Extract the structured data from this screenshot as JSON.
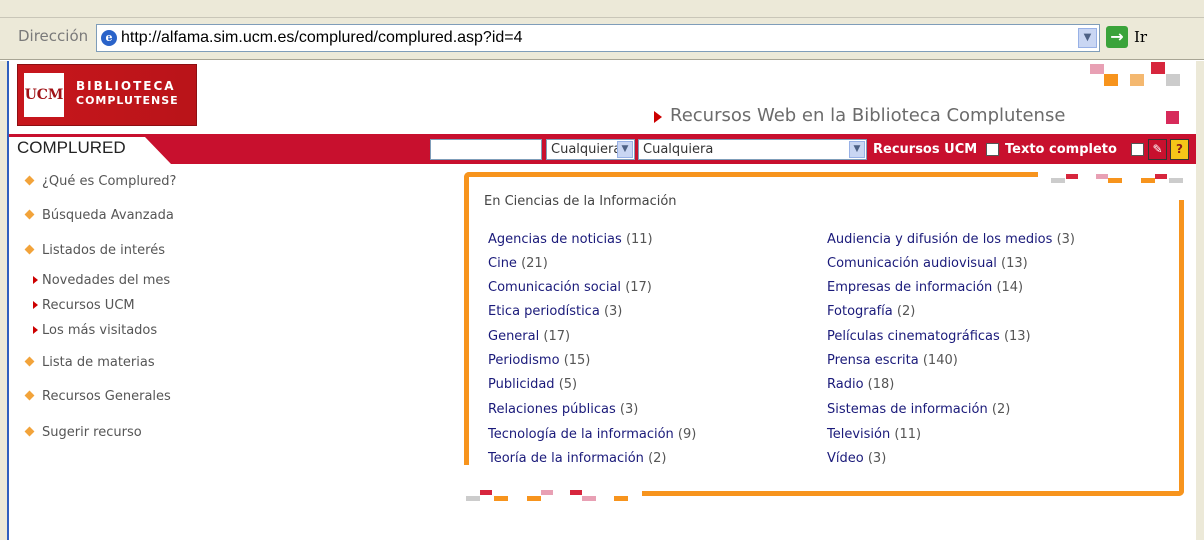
{
  "browser": {
    "address_label": "Dirección",
    "url": "http://alfama.sim.ucm.es/complured/complured.asp?id=4",
    "go_label": "Ir"
  },
  "header": {
    "logo_seal": "UCM",
    "logo_line1": "BIBLIOTECA",
    "logo_line2": "COMPLUTENSE",
    "title": "Recursos Web en la Biblioteca Complutense"
  },
  "searchbar": {
    "tab_label": "COMPLURED",
    "search_value": "",
    "select1_value": "Cualquiera",
    "select2_value": "Cualquiera",
    "check1_label": "Recursos UCM",
    "check2_label": "Texto completo",
    "accent_color": "#c8102e"
  },
  "sidebar": {
    "items": [
      {
        "label": "¿Qué es Complured?"
      },
      {
        "label": "Búsqueda Avanzada"
      },
      {
        "label": "Listados de interés"
      },
      {
        "label": "Lista de materias"
      },
      {
        "label": "Recursos Generales"
      },
      {
        "label": "Sugerir recurso"
      }
    ],
    "subitems": [
      {
        "label": "Novedades del mes"
      },
      {
        "label": "Recursos UCM"
      },
      {
        "label": "Los más visitados"
      }
    ]
  },
  "content": {
    "heading": "En Ciencias de la Información",
    "left_column": [
      {
        "name": "Agencias de noticias",
        "count": "(11)"
      },
      {
        "name": "Cine",
        "count": "(21)"
      },
      {
        "name": "Comunicación social",
        "count": "(17)"
      },
      {
        "name": "Etica periodística",
        "count": "(3)"
      },
      {
        "name": "General",
        "count": "(17)"
      },
      {
        "name": "Periodismo",
        "count": "(15)"
      },
      {
        "name": "Publicidad",
        "count": "(5)"
      },
      {
        "name": "Relaciones públicas",
        "count": "(3)"
      },
      {
        "name": "Tecnología de la información",
        "count": "(9)"
      },
      {
        "name": "Teoría de la información",
        "count": "(2)"
      }
    ],
    "right_column": [
      {
        "name": "Audiencia y difusión de los medios",
        "count": "(3)"
      },
      {
        "name": "Comunicación audiovisual",
        "count": "(13)"
      },
      {
        "name": "Empresas de información",
        "count": "(14)"
      },
      {
        "name": "Fotografía",
        "count": "(2)"
      },
      {
        "name": "Películas cinematográficas",
        "count": "(13)"
      },
      {
        "name": "Prensa escrita",
        "count": "(140)"
      },
      {
        "name": "Radio",
        "count": "(18)"
      },
      {
        "name": "Sistemas de información",
        "count": "(2)"
      },
      {
        "name": "Televisión",
        "count": "(11)"
      },
      {
        "name": "Vídeo",
        "count": "(3)"
      }
    ]
  }
}
